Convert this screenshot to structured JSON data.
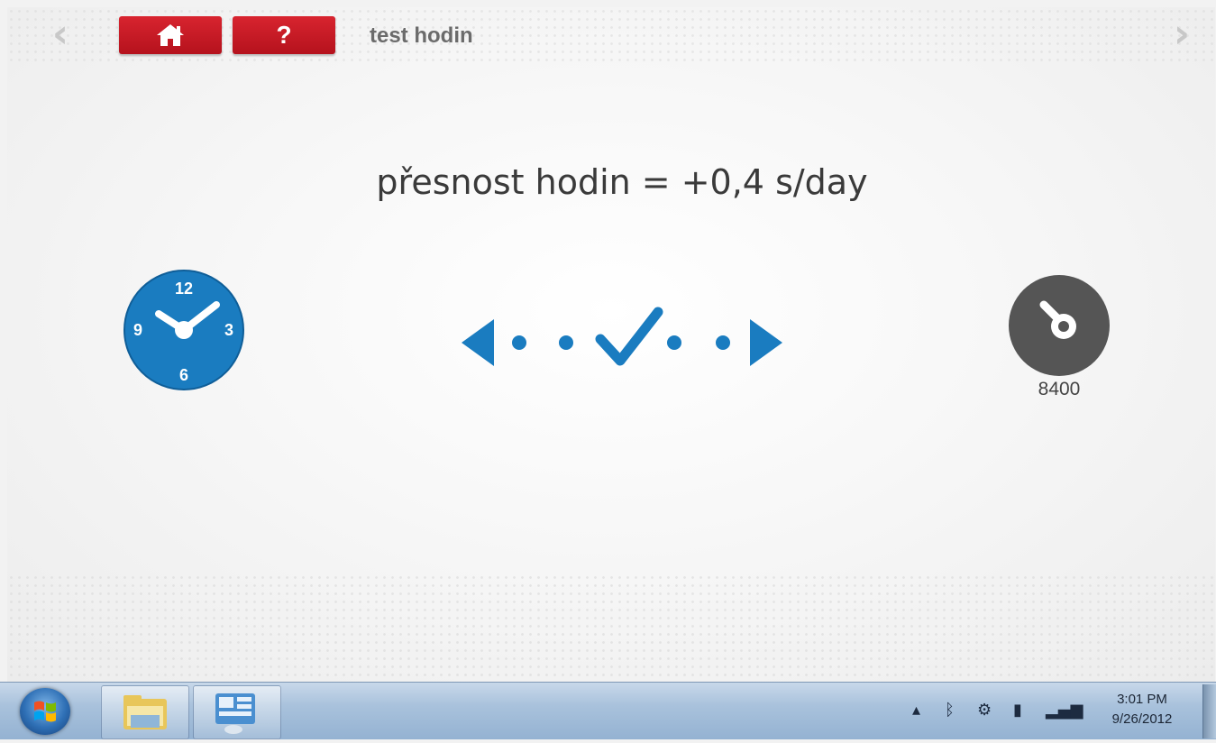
{
  "header": {
    "title": "test hodin",
    "help_label": "?",
    "prev_icon": "chevron-left-icon",
    "next_icon": "chevron-right-icon",
    "home_icon": "home-icon"
  },
  "main": {
    "headline": "přesnost hodin = +0,4 s/day",
    "clock_icon": "clock-icon",
    "clock_numbers": [
      "12",
      "3",
      "6",
      "9"
    ],
    "device_label": "8400",
    "status_icon": "check-icon"
  },
  "taskbar": {
    "time": "3:01 PM",
    "date": "9/26/2012",
    "tray_icons": [
      "show-hidden-icon",
      "bluetooth-icon",
      "network-icon",
      "device-icon",
      "signal-icon"
    ]
  },
  "colors": {
    "accent_red": "#c8161f",
    "accent_blue": "#1a7cc0",
    "dial_gray": "#555555"
  }
}
